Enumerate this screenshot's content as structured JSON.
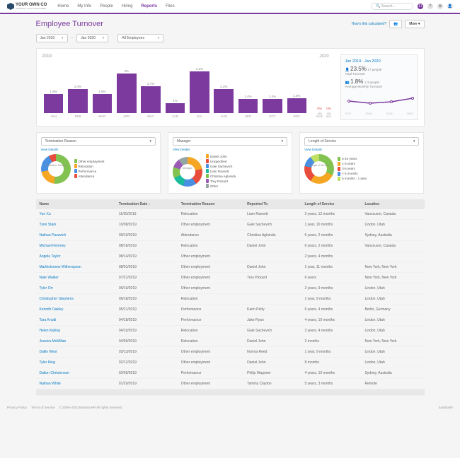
{
  "logo": {
    "brand": "YOUR OWN CO",
    "tagline": "COMPANY LOGO GOES HERE"
  },
  "nav": [
    "Home",
    "My Info",
    "People",
    "Hiring",
    "Reports",
    "Files"
  ],
  "nav_active": 4,
  "search": {
    "placeholder": "Search..."
  },
  "notif_count": "17",
  "page_title": "Employee Turnover",
  "calc_link": "How's this calculated?",
  "more_label": "More",
  "filters": {
    "start": "Jan 2019",
    "end": "Jan 2020",
    "emp": "All Employees"
  },
  "chart_data": {
    "type": "bar",
    "year_left": "2019",
    "year_right": "2020",
    "categories": [
      "JAN",
      "FEB",
      "MAR",
      "APR",
      "MAY",
      "JUN",
      "JUL",
      "AUG",
      "SEP",
      "OCT",
      "NOV"
    ],
    "values": [
      1.9,
      2.4,
      1.9,
      4.0,
      2.7,
      1.0,
      4.2,
      2.4,
      1.4,
      1.4,
      1.5
    ],
    "labels": [
      "1.9%",
      "2.4%",
      "1.9%",
      "4%",
      "2.7%",
      "1%",
      "4.2%",
      "2.4%",
      "1.4%",
      "1.4%",
      "1.5%"
    ],
    "right": [
      {
        "cat": "JAN RATE",
        "val": "0%"
      },
      {
        "cat": "JAN AVG",
        "val": "0%"
      }
    ],
    "ymax": 5
  },
  "stats": {
    "title": "Jan 2019 - Jan 2020",
    "total_pct": "23.5%",
    "total_people": "17 people",
    "total_label": "Total Turnover",
    "avg_pct": "1.8%",
    "avg_people": "1.3 people",
    "avg_label": "Average Monthly Turnover",
    "spark_years": [
      "2017",
      "2018",
      "2019",
      "2020"
    ]
  },
  "colors": {
    "green": "#82c250",
    "orange": "#f5a623",
    "blue": "#4a90e2",
    "red": "#e74c3c",
    "teal": "#1abc9c",
    "purple": "#9b59b6",
    "lime": "#c0e060",
    "gray": "#95a5a6"
  },
  "donuts": [
    {
      "label": "Termination Reason",
      "center": "Termination Reason",
      "legend": [
        [
          "green",
          "Other employment"
        ],
        [
          "orange",
          "Relocation"
        ],
        [
          "blue",
          "Performance"
        ],
        [
          "red",
          "Attendance"
        ]
      ],
      "bg": "conic-gradient(#82c250 0 52%,#f5a623 52% 72%,#4a90e2 72% 92%,#e74c3c 92% 100%)"
    },
    {
      "label": "Manager",
      "center": "Manager",
      "legend": [
        [
          "orange",
          "Daniel John"
        ],
        [
          "red",
          "Unspecified"
        ],
        [
          "blue",
          "Gale Sachevich"
        ],
        [
          "teal",
          "Liam Ravnett"
        ],
        [
          "green",
          "Christina Agluinda"
        ],
        [
          "purple",
          "Trey Pickard"
        ],
        [
          "gray",
          "Other"
        ]
      ],
      "bg": "conic-gradient(#f5a623 0 22%,#e74c3c 22% 40%,#4a90e2 40% 55%,#1abc9c 55% 68%,#82c250 68% 80%,#9b59b6 80% 90%,#95a5a6 90% 100%)"
    },
    {
      "label": "Length of Service",
      "center": "Length of Service",
      "legend": [
        [
          "green",
          "5-10 years"
        ],
        [
          "orange",
          "1-3 years"
        ],
        [
          "red",
          "3-5 years"
        ],
        [
          "blue",
          "< 6 months"
        ],
        [
          "lime",
          "6 months - 1 year"
        ]
      ],
      "bg": "conic-gradient(#82c250 0 32%,#f5a623 32% 60%,#e74c3c 60% 78%,#4a90e2 78% 90%,#c0e060 90% 100%)"
    }
  ],
  "view_details": "View Details",
  "table": {
    "cols": [
      "Name",
      "Termination Date ↓",
      "Termination Reason",
      "Reported To",
      "Length of Service",
      "Location"
    ],
    "rows": [
      [
        "Yun Xu",
        "11/05/2019",
        "Relocation",
        "Liam Ravnett",
        "3 years, 12 months",
        "Vancouver, Canada"
      ],
      [
        "Tyrel Stark",
        "10/08/2019",
        "Other employment",
        "Gale Sachevich",
        "1 year, 10 months",
        "Lindon, Utah"
      ],
      [
        "Nathan Pazavich",
        "09/10/2019",
        "Attendance",
        "Christina Agluinda",
        "6 years, 2 months",
        "Sydney, Australia"
      ],
      [
        "Michael Romney",
        "08/16/2019",
        "Relocation",
        "Daniel John",
        "6 years, 2 months",
        "Vancouver, Canada"
      ],
      [
        "Angela Taylor",
        "08/14/2019",
        "Other employment",
        "",
        "2 years, 4 months",
        ""
      ],
      [
        "Martholomew Witherspoon",
        "08/01/2019",
        "Other employment",
        "Daniel John",
        "1 year, 11 months",
        "New York, New York"
      ],
      [
        "Nate Walker",
        "07/21/2019",
        "Other employment",
        "Trey Pickard",
        "6 years",
        "New York, New York"
      ],
      [
        "Tyler Orr",
        "06/19/2019",
        "Other employment",
        "",
        "2 years, 9 months",
        "Lindon, Utah"
      ],
      [
        "Christopher Stephens",
        "06/18/2019",
        "Relocation",
        "",
        "1 year, 9 months",
        "Lindon, Utah"
      ],
      [
        "Kennith Oakley",
        "05/21/2019",
        "Performance",
        "Karin Petty",
        "6 years, 4 months",
        "Berlin, Germany"
      ],
      [
        "Tara Knutti",
        "04/18/2019",
        "Performance",
        "Jake Ryan",
        "4 years, 10 months",
        "Lindon, Utah"
      ],
      [
        "Helen Kipling",
        "04/10/2019",
        "Relocation",
        "Gale Sachevich",
        "3 years, 4 months",
        "Lindon, Utah"
      ],
      [
        "Jessica McMillan",
        "04/09/2019",
        "Relocation",
        "Daniel John",
        "2 months",
        "New York, New York"
      ],
      [
        "Dallin West",
        "03/13/2019",
        "Other employment",
        "Norma Reed",
        "1 year, 9 months",
        "Lindon, Utah"
      ],
      [
        "Tyler King",
        "02/12/2019",
        "Other employment",
        "Daniel John",
        "8 months",
        "Lindon, Utah"
      ],
      [
        "Dalton Christenson",
        "02/05/2019",
        "Performance",
        "Philip Wagoner",
        "4 years, 10 months",
        "Sydney, Australia"
      ],
      [
        "Nathan White",
        "01/29/2019",
        "Other employment",
        "Tammy Clayton",
        "5 years, 3 months",
        "Remote"
      ]
    ]
  },
  "footer": {
    "links": [
      "Privacy Policy",
      "Terms of Service"
    ],
    "copyright": "© 2008–2020 BambooHR All rights reserved",
    "brand": "bamboohr"
  }
}
